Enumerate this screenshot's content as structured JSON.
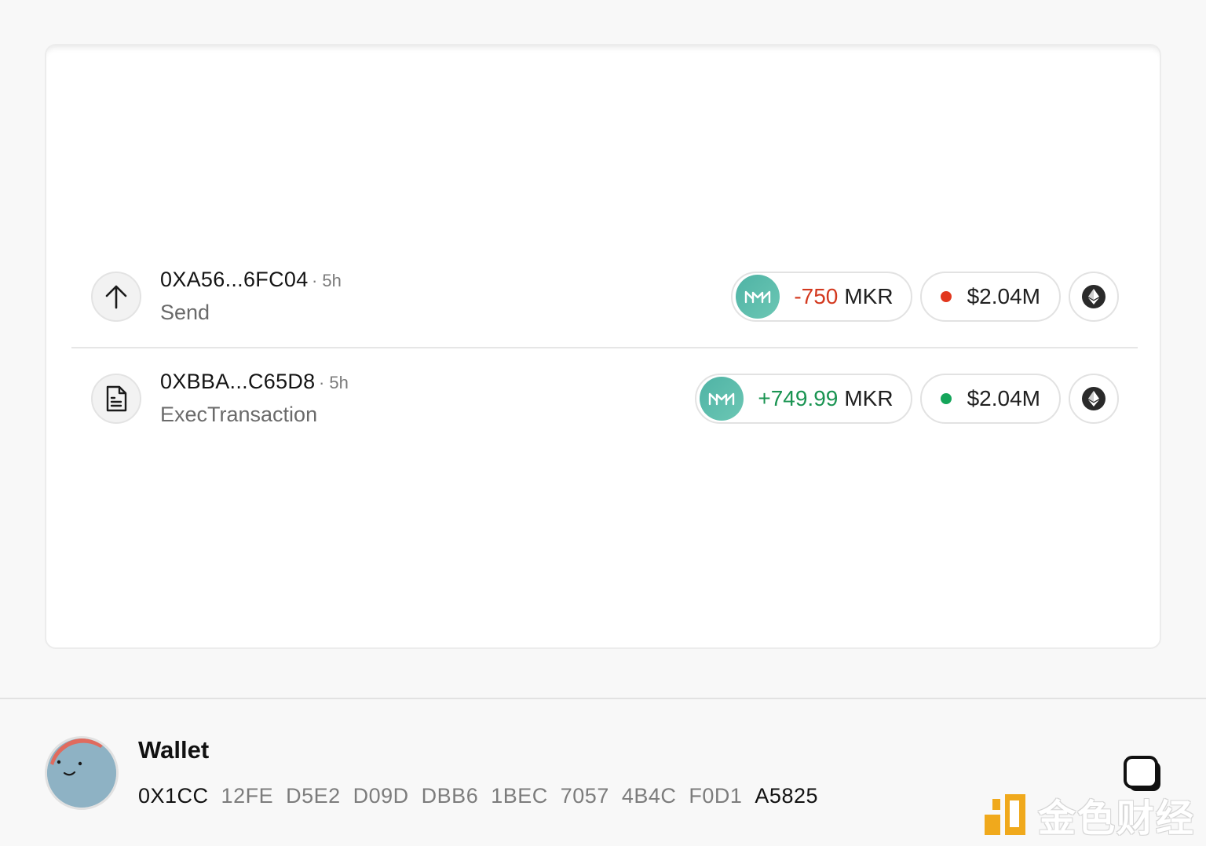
{
  "transactions": [
    {
      "address": "0XA56...6FC04",
      "time": "· 5h",
      "action": "Send",
      "icon": "arrow-up-icon",
      "token_amount": "-750",
      "token_symbol": "MKR",
      "token_icon": "maker-icon",
      "amount_color": "#d3391f",
      "usd_value": "$2.04M",
      "status_color": "#e2371e",
      "chain_icon": "ethereum-icon"
    },
    {
      "address": "0XBBA...C65D8",
      "time": "· 5h",
      "action": "ExecTransaction",
      "icon": "document-icon",
      "token_amount": "+749.99",
      "token_symbol": "MKR",
      "token_icon": "maker-icon",
      "amount_color": "#1a9452",
      "usd_value": "$2.04M",
      "status_color": "#14a55a",
      "chain_icon": "ethereum-icon"
    }
  ],
  "wallet": {
    "title": "Wallet",
    "address_groups": [
      "0X1CC",
      "12FE",
      "D5E2",
      "D09D",
      "DBB6",
      "1BEC",
      "7057",
      "4B4C",
      "F0D1",
      "A5825"
    ],
    "avatar": "face-avatar",
    "copy_icon": "copy-icon"
  },
  "watermark": {
    "text": "金色财经"
  }
}
